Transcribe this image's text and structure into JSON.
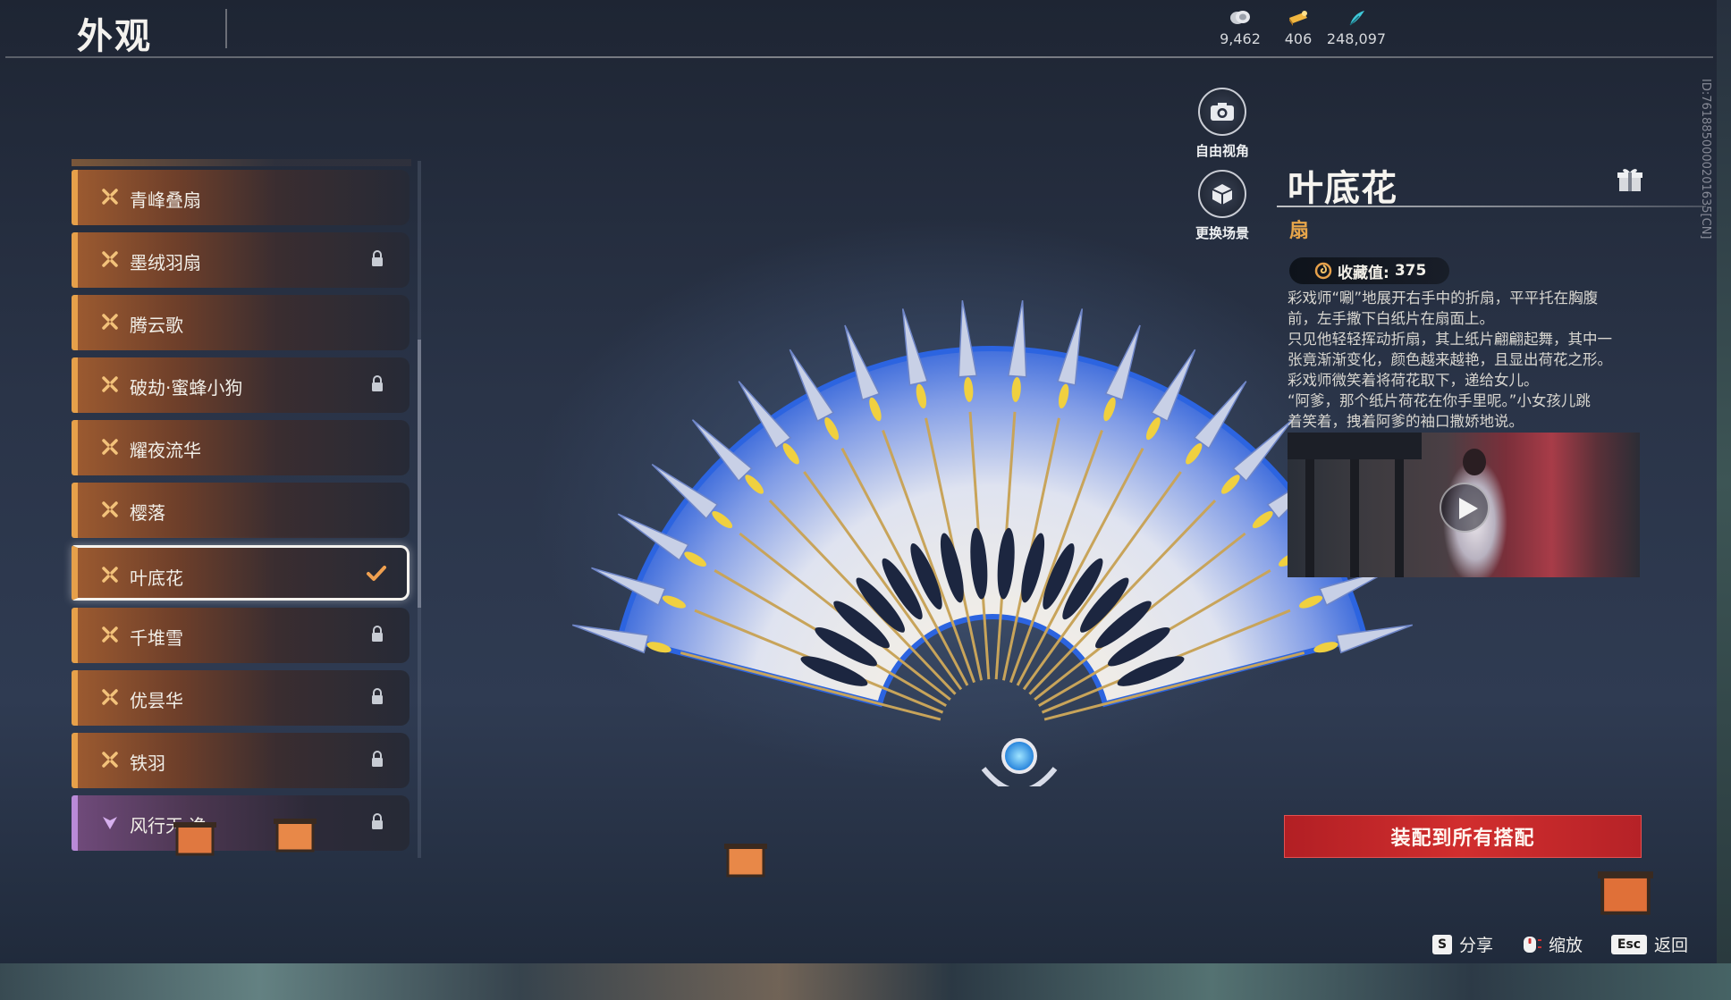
{
  "header": {
    "title": "外观",
    "currencies": [
      {
        "icon": "coin-stack-icon",
        "value": "9,462"
      },
      {
        "icon": "gold-ticket-icon",
        "value": "406"
      },
      {
        "icon": "jade-feather-icon",
        "value": "248,097"
      }
    ]
  },
  "list": {
    "items": [
      {
        "label": "青峰叠扇",
        "locked": false,
        "selected": false,
        "rarity": "orange"
      },
      {
        "label": "墨绒羽扇",
        "locked": true,
        "selected": false,
        "rarity": "orange"
      },
      {
        "label": "腾云歌",
        "locked": false,
        "selected": false,
        "rarity": "orange"
      },
      {
        "label": "破劫·蜜蜂小狗",
        "locked": true,
        "selected": false,
        "rarity": "orange"
      },
      {
        "label": "耀夜流华",
        "locked": false,
        "selected": false,
        "rarity": "orange"
      },
      {
        "label": "樱落",
        "locked": false,
        "selected": false,
        "rarity": "orange"
      },
      {
        "label": "叶底花",
        "locked": false,
        "selected": true,
        "rarity": "orange"
      },
      {
        "label": "千堆雪",
        "locked": true,
        "selected": false,
        "rarity": "orange"
      },
      {
        "label": "优昙华",
        "locked": true,
        "selected": false,
        "rarity": "orange"
      },
      {
        "label": "铁羽",
        "locked": true,
        "selected": false,
        "rarity": "orange"
      },
      {
        "label": "风行天·逸",
        "locked": true,
        "selected": false,
        "rarity": "purple"
      }
    ]
  },
  "camera": {
    "free_view_label": "自由视角",
    "change_scene_label": "更换场景"
  },
  "detail": {
    "name": "叶底花",
    "type": "扇",
    "collection_label": "收藏值:",
    "collection_value": "375",
    "description_lines": [
      "彩戏师“唰”地展开右手中的折扇，平平托在胸腹",
      "前，左手撒下白纸片在扇面上。",
      "只见他轻轻挥动折扇，其上纸片翩翩起舞，其中一",
      "张竟渐渐变化，颜色越来越艳，且显出荷花之形。",
      "彩戏师微笑着将荷花取下，递给女儿。",
      "“阿爹，那个纸片荷花在你手里呢。”小女孩儿跳",
      "着笑着，拽着阿爹的袖口撒娇地说。"
    ],
    "equip_label": "装配到所有搭配"
  },
  "footer": {
    "share_key": "S",
    "share_label": "分享",
    "zoom_label": "缩放",
    "back_key": "Esc",
    "back_label": "返回"
  },
  "version_id": "ID:7618850000201635[CN]",
  "colors": {
    "accent_orange": "#e6a04a",
    "equip_red": "#c82a2c",
    "rarity_purple": "#b98ad8",
    "fan_blue": "#2f6fe0"
  }
}
